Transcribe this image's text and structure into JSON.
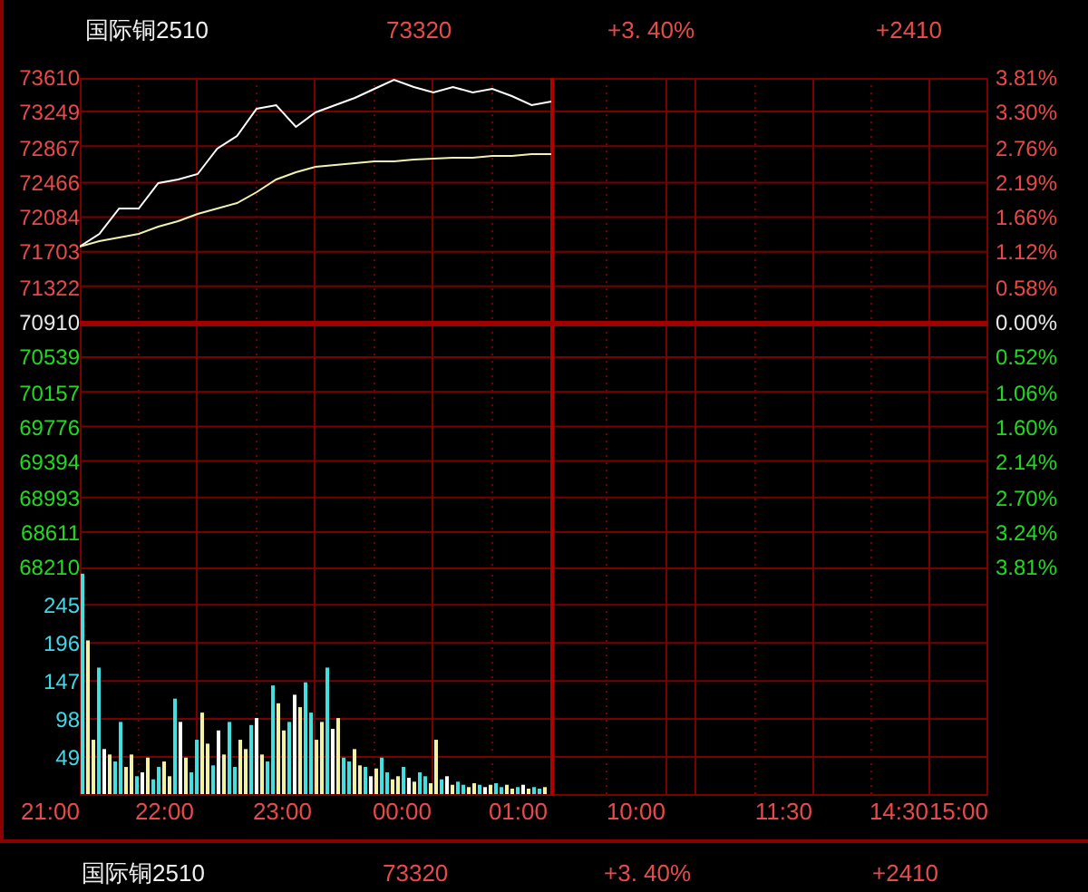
{
  "header": {
    "name": "国际铜2510",
    "price": "73320",
    "change_pct": "+3. 40%",
    "change": "+2410"
  },
  "percent_axis": [
    {
      "label": "3.81%",
      "kind": "up"
    },
    {
      "label": "3.30%",
      "kind": "up"
    },
    {
      "label": "2.76%",
      "kind": "up"
    },
    {
      "label": "2.19%",
      "kind": "up"
    },
    {
      "label": "1.66%",
      "kind": "up"
    },
    {
      "label": "1.12%",
      "kind": "up"
    },
    {
      "label": "0.58%",
      "kind": "up"
    },
    {
      "label": "0.00%",
      "kind": "flat"
    },
    {
      "label": "0.52%",
      "kind": "down"
    },
    {
      "label": "1.06%",
      "kind": "down"
    },
    {
      "label": "1.60%",
      "kind": "down"
    },
    {
      "label": "2.14%",
      "kind": "down"
    },
    {
      "label": "2.70%",
      "kind": "down"
    },
    {
      "label": "3.24%",
      "kind": "down"
    },
    {
      "label": "3.81%",
      "kind": "down"
    }
  ],
  "price_chart": {
    "chart_data": {
      "type": "line",
      "ylim": [
        68210,
        73610
      ],
      "grid": true,
      "ref_lines": [
        {
          "axis": "y",
          "value": 70910
        }
      ],
      "yticks": [
        {
          "value": 73610,
          "label": "73610"
        },
        {
          "value": 73249,
          "label": "73249"
        },
        {
          "value": 72867,
          "label": "72867"
        },
        {
          "value": 72466,
          "label": "72466"
        },
        {
          "value": 72084,
          "label": "72084"
        },
        {
          "value": 71703,
          "label": "71703"
        },
        {
          "value": 71322,
          "label": "71322"
        },
        {
          "value": 70910,
          "label": "70910"
        },
        {
          "value": 70539,
          "label": "70539"
        },
        {
          "value": 70157,
          "label": "70157"
        },
        {
          "value": 69776,
          "label": "69776"
        },
        {
          "value": 69394,
          "label": "69394"
        },
        {
          "value": 68993,
          "label": "68993"
        },
        {
          "value": 68611,
          "label": "68611"
        },
        {
          "value": 68210,
          "label": "68210"
        }
      ],
      "categories": [
        null,
        null,
        null,
        null,
        null,
        null,
        null,
        null,
        null,
        null,
        null,
        null,
        null,
        null,
        null,
        null,
        null,
        null,
        null,
        null,
        null,
        null,
        null,
        null,
        null
      ],
      "series": [
        {
          "color": "#ffffff",
          "values": [
            71750,
            71890,
            72170,
            72170,
            72450,
            72490,
            72550,
            72830,
            72970,
            73270,
            73310,
            73070,
            73230,
            73310,
            73390,
            73490,
            73590,
            73510,
            73450,
            73510,
            73450,
            73490,
            73410,
            73310,
            73350
          ]
        },
        {
          "color": "#f2f2b0",
          "values": [
            71750,
            71810,
            71850,
            71890,
            71970,
            72030,
            72110,
            72170,
            72230,
            72350,
            72490,
            72570,
            72630,
            72650,
            72670,
            72690,
            72690,
            72710,
            72720,
            72730,
            72730,
            72750,
            72750,
            72770,
            72770
          ]
        }
      ]
    }
  },
  "volume_chart": {
    "chart_data": {
      "type": "bar",
      "stacked": true,
      "ylim": [
        0,
        292
      ],
      "grid": true,
      "yticks": [
        {
          "value": 245,
          "label": "245"
        },
        {
          "value": 196,
          "label": "196"
        },
        {
          "value": 147,
          "label": "147"
        },
        {
          "value": 98,
          "label": "98"
        },
        {
          "value": 49,
          "label": "49"
        }
      ],
      "categories": [
        null,
        null,
        null,
        null,
        null,
        null,
        null,
        null,
        null,
        null,
        null,
        null,
        null,
        null,
        null,
        null,
        null,
        null,
        null,
        null,
        null,
        null,
        null,
        null,
        null,
        null,
        null,
        null,
        null,
        null,
        null,
        null,
        null,
        null,
        null,
        null,
        null,
        null,
        null,
        null,
        null,
        null,
        null,
        null,
        null,
        null,
        null,
        null,
        null,
        null,
        null,
        null,
        null,
        null,
        null,
        null,
        null,
        null,
        null,
        null,
        null,
        null,
        null,
        null,
        null,
        null,
        null,
        null,
        null,
        null,
        null,
        null,
        null,
        null,
        null,
        null,
        null,
        null,
        null,
        null,
        null,
        null,
        null,
        null,
        null,
        null,
        null,
        null,
        null,
        null,
        null,
        null,
        null,
        null,
        null,
        null,
        null,
        null,
        null,
        null,
        null,
        null,
        null,
        null,
        null,
        null,
        null,
        null,
        null,
        null,
        null,
        null,
        null,
        null,
        null,
        null,
        null,
        null,
        null,
        null,
        null,
        null,
        null,
        null,
        null,
        null,
        null,
        null,
        null,
        null,
        null,
        null,
        null,
        null,
        null,
        null,
        null,
        null,
        null,
        null,
        null,
        null,
        null,
        null,
        null,
        null,
        null,
        null,
        null,
        null,
        null,
        null,
        null,
        null,
        null,
        null,
        null,
        null,
        null,
        null,
        null,
        null,
        null,
        null,
        null,
        null,
        null
      ],
      "series": [
        {
          "color": "#40e0e0",
          "values": [
            284,
            null,
            null,
            163,
            null,
            null,
            42,
            93,
            null,
            null,
            23,
            null,
            null,
            19,
            35,
            null,
            null,
            123,
            null,
            null,
            28,
            70,
            null,
            null,
            37,
            null,
            null,
            93,
            35,
            null,
            null,
            89,
            null,
            null,
            42,
            140,
            null,
            null,
            93,
            null,
            null,
            144,
            105,
            null,
            null,
            163,
            null,
            null,
            47,
            42,
            null,
            null,
            35,
            null,
            null,
            47,
            28,
            null,
            null,
            35,
            null,
            null,
            28,
            23,
            null,
            null,
            19,
            null,
            null,
            16,
            12,
            null,
            null,
            12,
            null,
            null,
            14,
            9,
            null,
            null,
            9,
            null,
            null,
            9,
            7,
            null,
            null,
            null,
            null,
            null,
            null,
            null,
            null,
            null,
            null,
            null,
            null,
            null,
            null,
            null,
            null,
            null,
            null,
            null,
            null,
            null,
            null,
            null,
            null,
            null,
            null,
            null,
            null,
            null,
            null,
            null,
            null,
            null,
            null,
            null,
            null,
            null,
            null,
            null,
            null,
            null,
            null,
            null,
            null,
            null,
            null,
            null,
            null,
            null,
            null,
            null,
            null,
            null,
            null,
            null,
            null,
            null,
            null,
            null,
            null,
            null,
            null,
            null,
            null,
            null,
            null,
            null,
            null,
            null,
            null,
            null,
            null,
            null,
            null,
            null,
            null,
            null,
            null,
            null,
            null,
            null,
            null
          ]
        },
        {
          "color": "#f2f2a0",
          "values": [
            null,
            198,
            70,
            null,
            null,
            51,
            null,
            null,
            35,
            51,
            null,
            null,
            47,
            null,
            null,
            42,
            23,
            null,
            null,
            47,
            null,
            null,
            105,
            65,
            null,
            null,
            51,
            null,
            null,
            70,
            58,
            null,
            null,
            51,
            null,
            null,
            117,
            82,
            null,
            null,
            112,
            null,
            null,
            70,
            93,
            null,
            null,
            98,
            null,
            null,
            58,
            37,
            null,
            null,
            33,
            null,
            null,
            19,
            23,
            null,
            null,
            16,
            null,
            null,
            14,
            70,
            null,
            null,
            12,
            null,
            null,
            9,
            14,
            null,
            null,
            12,
            null,
            null,
            12,
            7,
            null,
            null,
            7,
            null,
            null,
            9,
            null,
            null,
            null,
            null,
            null,
            null,
            null,
            null,
            null,
            null,
            null,
            null,
            null,
            null,
            null,
            null,
            null,
            null,
            null,
            null,
            null,
            null,
            null,
            null,
            null,
            null,
            null,
            null,
            null,
            null,
            null,
            null,
            null,
            null,
            null,
            null,
            null,
            null,
            null,
            null,
            null,
            null,
            null,
            null,
            null,
            null,
            null,
            null,
            null,
            null,
            null,
            null,
            null,
            null,
            null,
            null,
            null,
            null,
            null,
            null,
            null,
            null,
            null,
            null,
            null,
            null,
            null,
            null,
            null,
            null,
            null,
            null,
            null,
            null,
            null,
            null,
            null,
            null,
            null,
            null,
            null
          ]
        },
        {
          "color": "#ffffff",
          "values": [
            null,
            null,
            null,
            null,
            58,
            null,
            null,
            null,
            null,
            null,
            null,
            28,
            null,
            null,
            null,
            null,
            null,
            null,
            93,
            null,
            null,
            null,
            null,
            null,
            null,
            82,
            null,
            null,
            null,
            null,
            null,
            null,
            98,
            null,
            null,
            null,
            null,
            null,
            null,
            128,
            null,
            null,
            null,
            null,
            null,
            null,
            84,
            null,
            null,
            null,
            null,
            null,
            null,
            23,
            null,
            null,
            null,
            null,
            null,
            null,
            21,
            null,
            null,
            null,
            null,
            null,
            null,
            23,
            null,
            null,
            null,
            null,
            null,
            null,
            9,
            null,
            null,
            null,
            null,
            null,
            null,
            12,
            null,
            null,
            null,
            null,
            null,
            null,
            null,
            null,
            null,
            null,
            null,
            null,
            null,
            null,
            null,
            null,
            null,
            null,
            null,
            null,
            null,
            null,
            null,
            null,
            null,
            null,
            null,
            null,
            null,
            null,
            null,
            null,
            null,
            null,
            null,
            null,
            null,
            null,
            null,
            null,
            null,
            null,
            null,
            null,
            null,
            null,
            null,
            null,
            null,
            null,
            null,
            null,
            null,
            null,
            null,
            null,
            null,
            null,
            null,
            null,
            null,
            null,
            null,
            null,
            null,
            null,
            null,
            null,
            null,
            null,
            null,
            null,
            null,
            null,
            null,
            null,
            null,
            null,
            null,
            null,
            null,
            null,
            null,
            null,
            null
          ]
        }
      ]
    }
  },
  "time_axis": [
    "21:00",
    "22:00",
    "23:00",
    "00:00",
    "01:00",
    "10:00",
    "11:30",
    "14:30",
    "15:00"
  ],
  "footer": {
    "name": "国际铜2510",
    "price": "73320",
    "change_pct": "+3. 40%",
    "change": "+2410"
  }
}
